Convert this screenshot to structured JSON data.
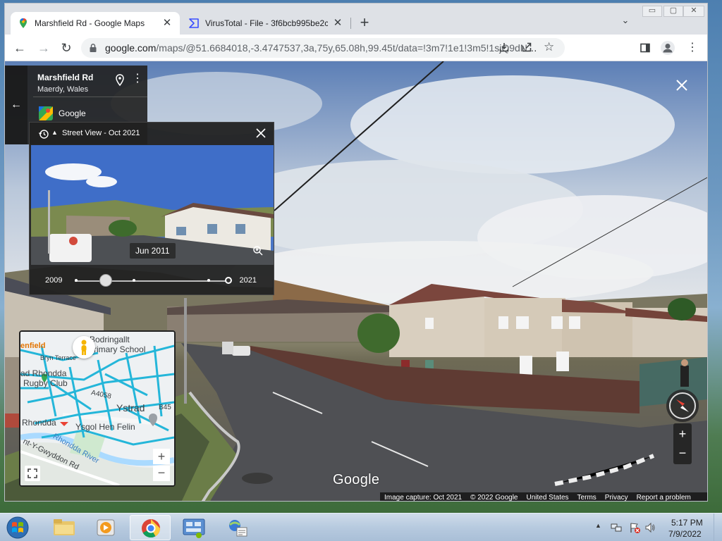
{
  "browser": {
    "tabs": [
      {
        "title": "Marshfield Rd - Google Maps",
        "icon": "google-maps-icon",
        "active": true
      },
      {
        "title": "VirusTotal - File - 3f6bcb995be2c",
        "icon": "virustotal-icon",
        "active": false
      }
    ],
    "new_tab": "+",
    "url_domain": "google.com",
    "url_rest": "/maps/@51.6684018,-3.4747537,3a,75y,65.08h,99.45t/data=!3m7!1e1!3m5!1sjQ9dNNKorL..."
  },
  "place_card": {
    "name": "Marshfield Rd",
    "subtitle": "Maerdy, Wales",
    "brand": "Google"
  },
  "time_machine": {
    "title": "Street View - Oct 2021",
    "thumb_date": "Jun 2011",
    "start_year": "2009",
    "end_year": "2021",
    "selected_fraction": 0.2
  },
  "minimap": {
    "labels": {
      "marshfield": "enfield",
      "school1": "Bodringallt",
      "school2": "rimary School",
      "terrace": "Bryn Terrace",
      "rugby1": "ad Rhondda",
      "rugby2": "Rugby Club",
      "road_a4058": "A4058",
      "ystrad": "Ystrad",
      "b45": "B45",
      "rhondda": "Rhondda",
      "ysgol": "Ysgol Hen Felin",
      "river": "Rhondda River",
      "gwyddon": "nt-Y-Gwyddon Rd"
    },
    "zoom_in": "+",
    "zoom_out": "−"
  },
  "streetview": {
    "zoom_in": "+",
    "zoom_out": "−",
    "watermark": "Google"
  },
  "footer": {
    "capture": "Image capture: Oct 2021",
    "copyright": "© 2022 Google",
    "country": "United States",
    "terms": "Terms",
    "privacy": "Privacy",
    "report": "Report a problem"
  },
  "taskbar": {
    "time": "5:17 PM",
    "date": "7/9/2022"
  },
  "colors": {
    "maps_road": "#24b6d9",
    "maps_pin_green": "#34a853",
    "rhondda_red": "#ea4335"
  }
}
